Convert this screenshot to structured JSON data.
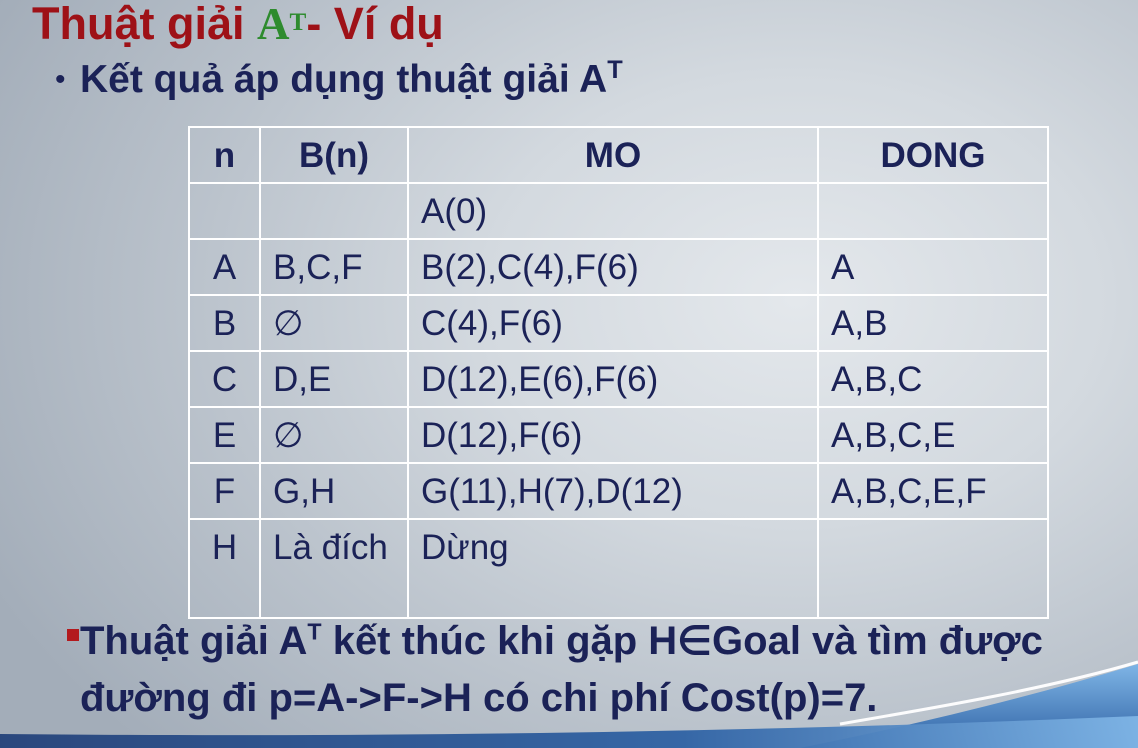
{
  "slide": {
    "title": {
      "text_before": "Thuật giải ",
      "algo_letter": "A",
      "algo_sup": "T",
      "text_after": "- Ví dụ"
    },
    "bullet": {
      "marker": "•",
      "text": "Kết quả áp dụng thuật giải A",
      "sup": "T"
    },
    "table": {
      "headers": [
        "n",
        "B(n)",
        "MO",
        "DONG"
      ],
      "rows": [
        [
          "",
          "",
          "A(0)",
          ""
        ],
        [
          "A",
          "B,C,F",
          "B(2),C(4),F(6)",
          "A"
        ],
        [
          "B",
          "∅",
          "C(4),F(6)",
          "A,B"
        ],
        [
          "C",
          "D,E",
          "D(12),E(6),F(6)",
          "A,B,C"
        ],
        [
          "E",
          "∅",
          "D(12),F(6)",
          "A,B,C,E"
        ],
        [
          "F",
          "G,H",
          "G(11),H(7),D(12)",
          "A,B,C,E,F"
        ],
        [
          "H",
          "Là đích",
          "Dừng",
          ""
        ]
      ]
    },
    "conclusion": {
      "line1_before": "Thuật giải A",
      "line1_sup": "T",
      "line1_after": " kết thúc khi gặp H∈Goal và tìm được",
      "line2": "đường đi p=A->F->H có chi phí Cost(p)=7."
    }
  },
  "colors": {
    "title_red": "#9e1117",
    "title_green": "#2e8b2e",
    "text_navy": "#1b2257",
    "table_border": "#ffffff",
    "square_bullet_red": "#b3191d",
    "deco_dark_blue": "#24427a",
    "deco_mid_blue": "#2f62a4",
    "deco_light_blue": "#7fb5e6",
    "deco_line_white": "#ffffff"
  }
}
